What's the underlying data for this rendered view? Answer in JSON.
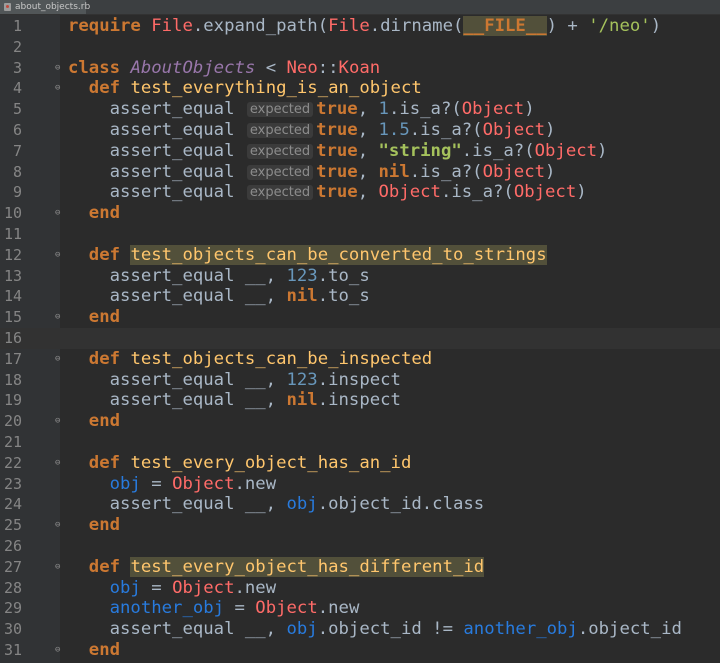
{
  "tab": {
    "label": "about_objects.rb"
  },
  "editor": {
    "lines": [
      {
        "num": "1",
        "parts": [
          {
            "t": "require ",
            "c": "k"
          },
          {
            "t": "File",
            "c": "const"
          },
          {
            "t": ".expand_path(",
            "c": ""
          },
          {
            "t": "File",
            "c": "const"
          },
          {
            "t": ".dirname(",
            "c": ""
          },
          {
            "t": "__FILE__",
            "c": "k hl"
          },
          {
            "t": ") + ",
            "c": ""
          },
          {
            "t": "'/neo'",
            "c": "s"
          },
          {
            "t": ")",
            "c": ""
          }
        ]
      },
      {
        "num": "2",
        "parts": []
      },
      {
        "num": "3",
        "fold": "⊖",
        "parts": [
          {
            "t": "class ",
            "c": "k"
          },
          {
            "t": "AboutObjects",
            "c": "cls"
          },
          {
            "t": " < ",
            "c": ""
          },
          {
            "t": "Neo",
            "c": "const"
          },
          {
            "t": "::",
            "c": ""
          },
          {
            "t": "Koan",
            "c": "const"
          }
        ]
      },
      {
        "num": "4",
        "fold": "⊖",
        "parts": [
          {
            "t": "  def ",
            "c": "k"
          },
          {
            "t": "test_everything_is_an_object",
            "c": "fn"
          }
        ]
      },
      {
        "num": "5",
        "parts": [
          {
            "t": "    assert_equal ",
            "c": ""
          },
          {
            "t": "expected",
            "c": "hint"
          },
          {
            "t": "true",
            "c": "k"
          },
          {
            "t": ", ",
            "c": ""
          },
          {
            "t": "1",
            "c": "n"
          },
          {
            "t": ".is_a?(",
            "c": ""
          },
          {
            "t": "Object",
            "c": "const"
          },
          {
            "t": ")",
            "c": ""
          }
        ]
      },
      {
        "num": "6",
        "parts": [
          {
            "t": "    assert_equal ",
            "c": ""
          },
          {
            "t": "expected",
            "c": "hint"
          },
          {
            "t": "true",
            "c": "k"
          },
          {
            "t": ", ",
            "c": ""
          },
          {
            "t": "1.5",
            "c": "n"
          },
          {
            "t": ".is_a?(",
            "c": ""
          },
          {
            "t": "Object",
            "c": "const"
          },
          {
            "t": ")",
            "c": ""
          }
        ]
      },
      {
        "num": "7",
        "parts": [
          {
            "t": "    assert_equal ",
            "c": ""
          },
          {
            "t": "expected",
            "c": "hint"
          },
          {
            "t": "true",
            "c": "k"
          },
          {
            "t": ", ",
            "c": ""
          },
          {
            "t": "\"string\"",
            "c": "sb"
          },
          {
            "t": ".is_a?(",
            "c": ""
          },
          {
            "t": "Object",
            "c": "const"
          },
          {
            "t": ")",
            "c": ""
          }
        ]
      },
      {
        "num": "8",
        "parts": [
          {
            "t": "    assert_equal ",
            "c": ""
          },
          {
            "t": "expected",
            "c": "hint"
          },
          {
            "t": "true",
            "c": "k"
          },
          {
            "t": ", ",
            "c": ""
          },
          {
            "t": "nil",
            "c": "k"
          },
          {
            "t": ".is_a?(",
            "c": ""
          },
          {
            "t": "Object",
            "c": "const"
          },
          {
            "t": ")",
            "c": ""
          }
        ]
      },
      {
        "num": "9",
        "parts": [
          {
            "t": "    assert_equal ",
            "c": ""
          },
          {
            "t": "expected",
            "c": "hint"
          },
          {
            "t": "true",
            "c": "k"
          },
          {
            "t": ", ",
            "c": ""
          },
          {
            "t": "Object",
            "c": "const"
          },
          {
            "t": ".is_a?(",
            "c": ""
          },
          {
            "t": "Object",
            "c": "const"
          },
          {
            "t": ")",
            "c": ""
          }
        ]
      },
      {
        "num": "10",
        "fold": "⊖",
        "parts": [
          {
            "t": "  end",
            "c": "k"
          }
        ]
      },
      {
        "num": "11",
        "parts": []
      },
      {
        "num": "12",
        "fold": "⊖",
        "parts": [
          {
            "t": "  def ",
            "c": "k"
          },
          {
            "t": "test_objects_can_be_converted_to_strings",
            "c": "fn hl"
          }
        ]
      },
      {
        "num": "13",
        "parts": [
          {
            "t": "    assert_equal __, ",
            "c": ""
          },
          {
            "t": "123",
            "c": "n"
          },
          {
            "t": ".to_s",
            "c": ""
          }
        ]
      },
      {
        "num": "14",
        "parts": [
          {
            "t": "    assert_equal __, ",
            "c": ""
          },
          {
            "t": "nil",
            "c": "k"
          },
          {
            "t": ".to_s",
            "c": ""
          }
        ]
      },
      {
        "num": "15",
        "fold": "⊖",
        "parts": [
          {
            "t": "  end",
            "c": "k"
          }
        ]
      },
      {
        "num": "16",
        "current": true,
        "parts": []
      },
      {
        "num": "17",
        "fold": "⊖",
        "parts": [
          {
            "t": "  def ",
            "c": "k"
          },
          {
            "t": "test_objects_can_be_inspected",
            "c": "fn"
          }
        ]
      },
      {
        "num": "18",
        "parts": [
          {
            "t": "    assert_equal __, ",
            "c": ""
          },
          {
            "t": "123",
            "c": "n"
          },
          {
            "t": ".inspect",
            "c": ""
          }
        ]
      },
      {
        "num": "19",
        "parts": [
          {
            "t": "    assert_equal __, ",
            "c": ""
          },
          {
            "t": "nil",
            "c": "k"
          },
          {
            "t": ".inspect",
            "c": ""
          }
        ]
      },
      {
        "num": "20",
        "fold": "⊖",
        "parts": [
          {
            "t": "  end",
            "c": "k"
          }
        ]
      },
      {
        "num": "21",
        "parts": []
      },
      {
        "num": "22",
        "fold": "⊖",
        "parts": [
          {
            "t": "  def ",
            "c": "k"
          },
          {
            "t": "test_every_object_has_an_id",
            "c": "fn"
          }
        ]
      },
      {
        "num": "23",
        "parts": [
          {
            "t": "    ",
            "c": ""
          },
          {
            "t": "obj",
            "c": "v"
          },
          {
            "t": " = ",
            "c": ""
          },
          {
            "t": "Object",
            "c": "const"
          },
          {
            "t": ".new",
            "c": ""
          }
        ]
      },
      {
        "num": "24",
        "parts": [
          {
            "t": "    assert_equal __, ",
            "c": ""
          },
          {
            "t": "obj",
            "c": "v"
          },
          {
            "t": ".object_id.class",
            "c": ""
          }
        ]
      },
      {
        "num": "25",
        "fold": "⊖",
        "parts": [
          {
            "t": "  end",
            "c": "k"
          }
        ]
      },
      {
        "num": "26",
        "parts": []
      },
      {
        "num": "27",
        "fold": "⊖",
        "parts": [
          {
            "t": "  def ",
            "c": "k"
          },
          {
            "t": "test_every_object_has_different_id",
            "c": "fn hl"
          }
        ]
      },
      {
        "num": "28",
        "parts": [
          {
            "t": "    ",
            "c": ""
          },
          {
            "t": "obj",
            "c": "v"
          },
          {
            "t": " = ",
            "c": ""
          },
          {
            "t": "Object",
            "c": "const"
          },
          {
            "t": ".new",
            "c": ""
          }
        ]
      },
      {
        "num": "29",
        "parts": [
          {
            "t": "    ",
            "c": ""
          },
          {
            "t": "another_obj",
            "c": "v"
          },
          {
            "t": " = ",
            "c": ""
          },
          {
            "t": "Object",
            "c": "const"
          },
          {
            "t": ".new",
            "c": ""
          }
        ]
      },
      {
        "num": "30",
        "parts": [
          {
            "t": "    assert_equal __, ",
            "c": ""
          },
          {
            "t": "obj",
            "c": "v"
          },
          {
            "t": ".object_id != ",
            "c": ""
          },
          {
            "t": "another_obj",
            "c": "v"
          },
          {
            "t": ".object_id",
            "c": ""
          }
        ]
      },
      {
        "num": "31",
        "fold": "⊖",
        "parts": [
          {
            "t": "  end",
            "c": "k"
          }
        ]
      }
    ]
  },
  "colors": {
    "background": "#2b2b2b",
    "gutter": "#313335",
    "keyword": "#cc7832",
    "class_name": "#9876aa",
    "constant": "#ff6b68",
    "number": "#6897bb",
    "string": "#a5c25c",
    "method_name": "#ffc66d",
    "variable": "#287bde"
  },
  "icons": {
    "tab_file": "ruby-file-icon",
    "tab_close": "close-icon",
    "fold": "fold-marker-icon"
  }
}
